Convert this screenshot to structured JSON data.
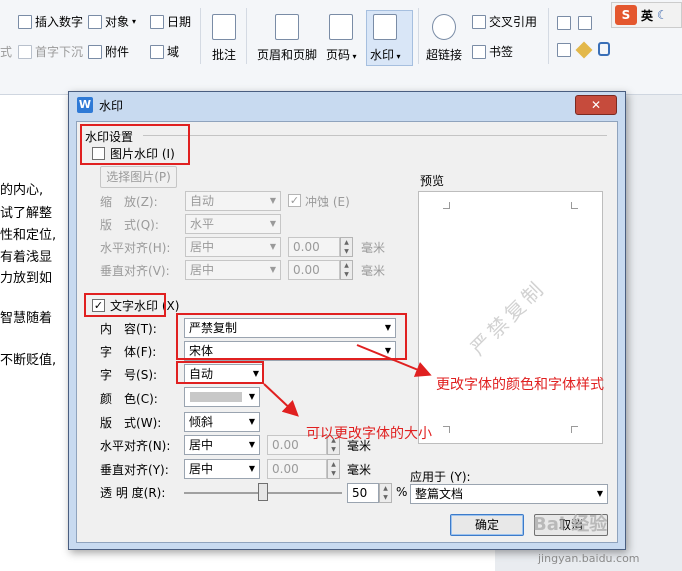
{
  "ribbon": {
    "insert_number": "插入数字",
    "object": "对象",
    "date": "日期",
    "style_partial": "式",
    "drop_cap": "首字下沉",
    "attachment": "附件",
    "field": "域",
    "comment": "批注",
    "header_footer": "页眉和页脚",
    "page_number": "页码",
    "watermark": "水印",
    "hyperlink": "超链接",
    "cross_ref": "交叉引用",
    "bookmark": "书签",
    "ime_label": "英"
  },
  "document": {
    "lines": [
      "的内心,",
      "试了解整",
      "性和定位,",
      "有着浅显",
      "力放到如",
      "智慧随着",
      "不断贬值,"
    ]
  },
  "dialog": {
    "title": "水印",
    "section": "水印设置",
    "image_wm": {
      "label": "图片水印",
      "shortcut": "(I)",
      "checked": false,
      "select_button": "选择图片",
      "select_shortcut": "(P)",
      "scale_label": "缩　放",
      "scale_shortcut": "(Z):",
      "scale_value": "自动",
      "washout_label": "冲蚀",
      "washout_shortcut": "(E)",
      "layout_label": "版　式",
      "layout_shortcut": "(Q):",
      "layout_value": "水平",
      "halign_label": "水平对齐",
      "halign_shortcut": "(H):",
      "halign_value": "居中",
      "halign_offset": "0.00",
      "valign_label": "垂直对齐",
      "valign_shortcut": "(V):",
      "valign_value": "居中",
      "valign_offset": "0.00",
      "unit": "毫米"
    },
    "text_wm": {
      "label": "文字水印",
      "shortcut": "(X)",
      "checked": true,
      "content_label": "内　容",
      "content_shortcut": "(T):",
      "content_value": "严禁复制",
      "font_label": "字　体",
      "font_shortcut": "(F):",
      "font_value": "宋体",
      "size_label": "字　号",
      "size_shortcut": "(S):",
      "size_value": "自动",
      "color_label": "颜　色",
      "color_shortcut": "(C):",
      "layout_label": "版　式",
      "layout_shortcut": "(W):",
      "layout_value": "倾斜",
      "halign_label": "水平对齐",
      "halign_shortcut": "(N):",
      "halign_value": "居中",
      "halign_offset": "0.00",
      "valign_label": "垂直对齐",
      "valign_shortcut": "(Y):",
      "valign_value": "居中",
      "valign_offset": "0.00",
      "unit": "毫米",
      "transparency_label": "透 明 度",
      "transparency_shortcut": "(R):",
      "transparency_value": "50",
      "transparency_unit": "%",
      "transparency_level": 0.5
    },
    "preview_label": "预览",
    "preview_watermark": "严禁复制",
    "apply_label": "应用于",
    "apply_shortcut": "(Y):",
    "apply_value": "整篇文档",
    "ok": "确定",
    "cancel": "取消"
  },
  "annotations": {
    "font_note": "更改字体的颜色和字体样式",
    "size_note": "可以更改字体的大小",
    "color": "#e02020"
  },
  "branding": {
    "watermark": "Bai 经验",
    "url": "jingyan.baidu.com"
  }
}
